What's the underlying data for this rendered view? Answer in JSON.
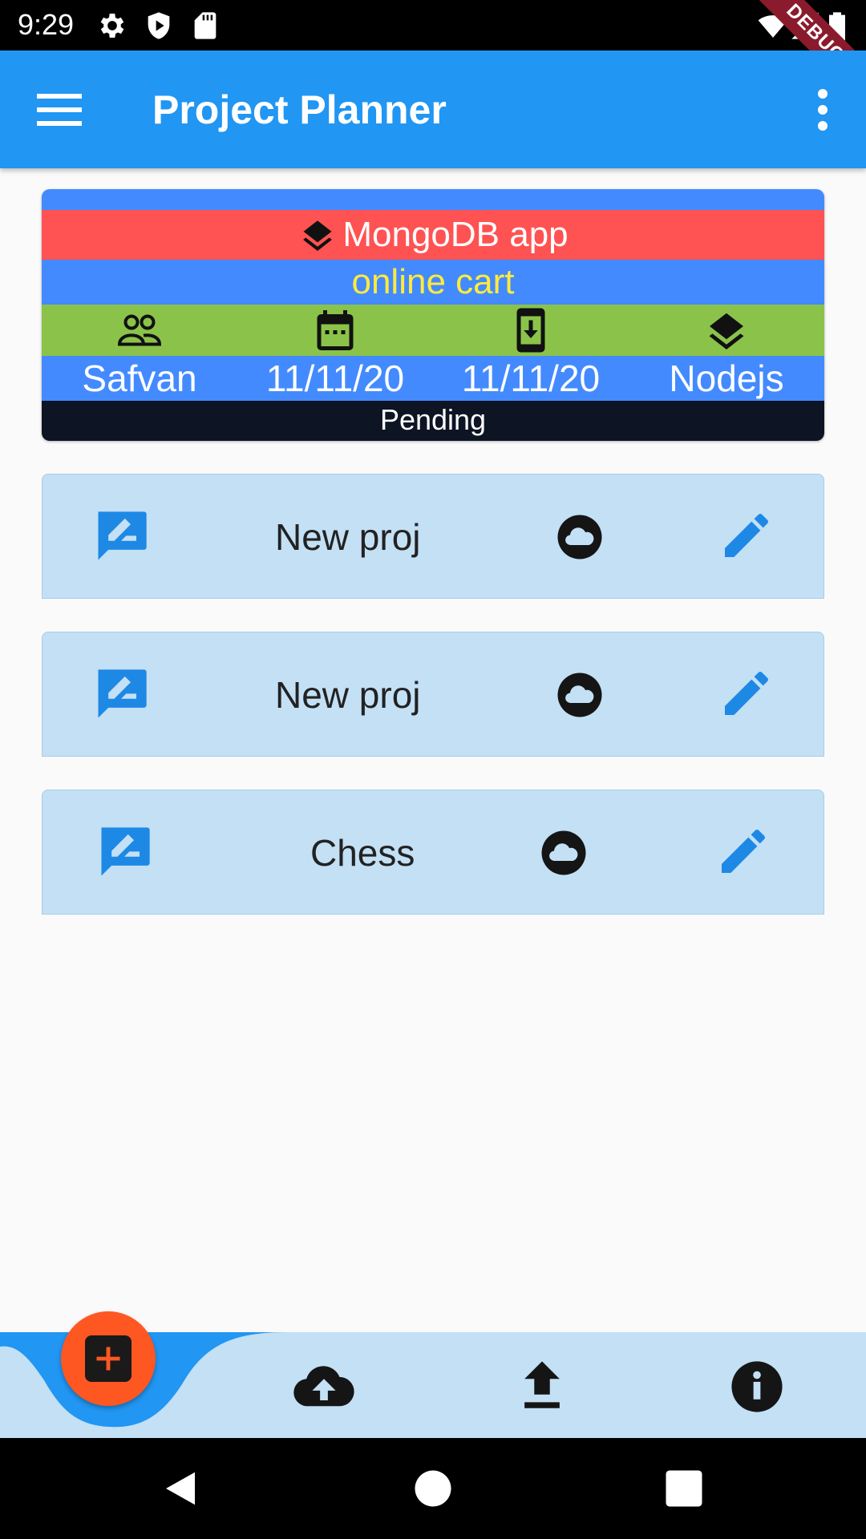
{
  "status_bar": {
    "time": "9:29",
    "debug_label": "DEBUG",
    "icons": [
      "settings-icon",
      "shield-play-icon",
      "sd-card-icon",
      "wifi-icon",
      "signal-icon",
      "battery-icon"
    ]
  },
  "app_bar": {
    "title": "Project Planner",
    "leading_icon": "menu-icon",
    "trailing_icon": "more-vert-icon",
    "color": "#2196f3"
  },
  "project_card": {
    "name": "MongoDB app",
    "description": "online cart",
    "icons": [
      "people-icon",
      "calendar-icon",
      "phone-download-icon",
      "layers-icon"
    ],
    "values": [
      "Safvan",
      "11/11/20",
      "11/11/20",
      "Nodejs"
    ],
    "status": "Pending",
    "colors": {
      "header_band": "#ff5252",
      "blue_band": "#448aff",
      "icon_band": "#8bc34a",
      "status_band": "#0d1424",
      "description_text": "#ffeb3b"
    }
  },
  "list_items": [
    {
      "label": "New proj",
      "icons": [
        "rate-review-icon",
        "cloud-icon",
        "edit-icon"
      ]
    },
    {
      "label": "New proj",
      "icons": [
        "rate-review-icon",
        "cloud-icon",
        "edit-icon"
      ]
    },
    {
      "label": "Chess",
      "icons": [
        "rate-review-icon",
        "cloud-icon",
        "edit-icon"
      ]
    }
  ],
  "bottom_nav": {
    "fab_icon": "add-box-icon",
    "items": [
      "cloud-upload-icon",
      "upload-icon",
      "info-icon"
    ],
    "colors": {
      "background": "#c3e0f5",
      "fab": "#ff5722"
    }
  },
  "system_nav": [
    "back-icon",
    "home-icon",
    "recents-icon"
  ]
}
